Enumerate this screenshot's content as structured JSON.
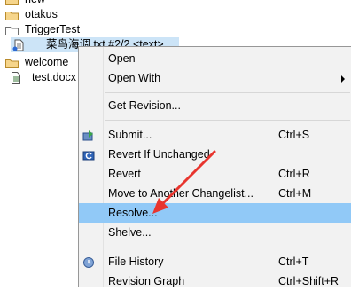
{
  "tree": {
    "items": [
      {
        "label": "new",
        "type": "folder"
      },
      {
        "label": "otakus",
        "type": "folder"
      },
      {
        "label": "TriggerTest",
        "type": "folder"
      },
      {
        "label": "菜鸟海调.txt #2/2 <text>",
        "type": "file-selected"
      },
      {
        "label": "welcome",
        "type": "folder"
      },
      {
        "label": "test.docx",
        "type": "file"
      }
    ]
  },
  "menu": {
    "items": [
      {
        "label": "Open",
        "shortcut": ""
      },
      {
        "label": "Open With",
        "shortcut": "",
        "submenu": true
      },
      {
        "label": "Get Revision...",
        "shortcut": ""
      },
      {
        "label": "Submit...",
        "shortcut": "Ctrl+S",
        "icon": "submit-icon"
      },
      {
        "label": "Revert If Unchanged",
        "shortcut": "",
        "icon": "revert-icon"
      },
      {
        "label": "Revert",
        "shortcut": "Ctrl+R"
      },
      {
        "label": "Move to Another Changelist...",
        "shortcut": "Ctrl+M"
      },
      {
        "label": "Resolve...",
        "shortcut": "",
        "highlighted": true
      },
      {
        "label": "Shelve...",
        "shortcut": ""
      },
      {
        "label": "File History",
        "shortcut": "Ctrl+T",
        "icon": "history-icon"
      },
      {
        "label": "Revision Graph",
        "shortcut": "Ctrl+Shift+R"
      }
    ]
  },
  "colors": {
    "highlight": "#91c9f7",
    "selection": "#cce4f7",
    "arrow": "#e8352e"
  }
}
